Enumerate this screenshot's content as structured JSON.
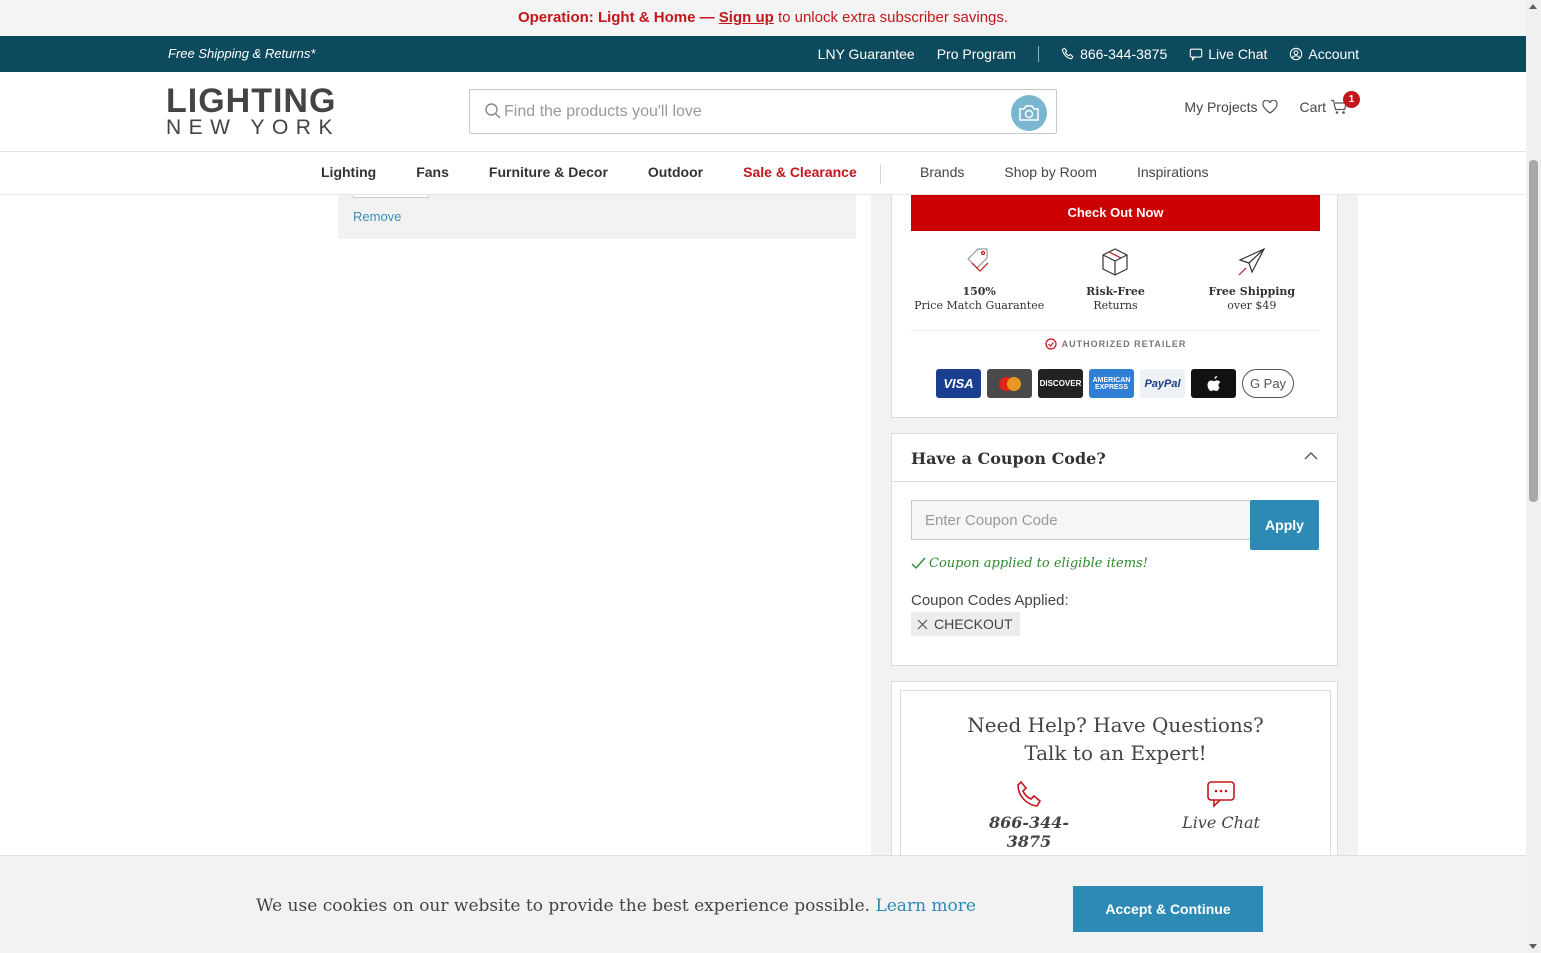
{
  "announcement": {
    "prefix": "Operation: Light & Home",
    "dash": " — ",
    "signup": "Sign up",
    "suffix": " to unlock extra subscriber savings."
  },
  "utility": {
    "free_shipping": "Free Shipping & Returns*",
    "lny_guarantee": "LNY Guarantee",
    "pro_program": "Pro Program",
    "phone": "866-344-3875",
    "live_chat": "Live Chat",
    "account": "Account"
  },
  "logo": {
    "line1": "LIGHTING",
    "line2": "NEW YORK"
  },
  "search": {
    "placeholder": "Find the products you'll love"
  },
  "header": {
    "my_projects": "My Projects",
    "cart": "Cart",
    "cart_count": "1"
  },
  "nav": {
    "primary": [
      "Lighting",
      "Fans",
      "Furniture & Decor",
      "Outdoor",
      "Sale & Clearance"
    ],
    "secondary": [
      "Brands",
      "Shop by Room",
      "Inspirations"
    ]
  },
  "cart_item": {
    "remove": "Remove"
  },
  "summary": {
    "checkout": "Check Out Now",
    "perks": [
      {
        "title": "150%",
        "sub": "Price Match Guarantee",
        "icon": "price-tag-icon"
      },
      {
        "title": "Risk-Free",
        "sub": "Returns",
        "icon": "box-icon"
      },
      {
        "title": "Free Shipping",
        "sub": "over $49",
        "icon": "airplane-icon"
      }
    ],
    "authorized": "AUTHORIZED RETAILER",
    "payments": [
      "VISA",
      "MasterCard",
      "DISCOVER",
      "AMERICAN EXPRESS",
      "PayPal",
      "Apple Pay",
      "G Pay"
    ]
  },
  "coupon": {
    "title": "Have a Coupon Code?",
    "placeholder": "Enter Coupon Code",
    "apply": "Apply",
    "success": "Coupon applied to eligible items!",
    "applied_label": "Coupon Codes Applied:",
    "code": "CHECKOUT"
  },
  "help": {
    "line1": "Need Help? Have Questions?",
    "line2": "Talk to an Expert!",
    "phone": "866-344-3875",
    "chat": "Live Chat"
  },
  "cookie": {
    "message": "We use cookies on our website to provide the best experience possible.",
    "learn_more": "Learn more",
    "accept": "Accept & Continue"
  },
  "colors": {
    "brand_teal": "#0d4a5e",
    "accent_red": "#c4151c",
    "checkout_red": "#cc0000",
    "action_blue": "#2d8ab4"
  }
}
